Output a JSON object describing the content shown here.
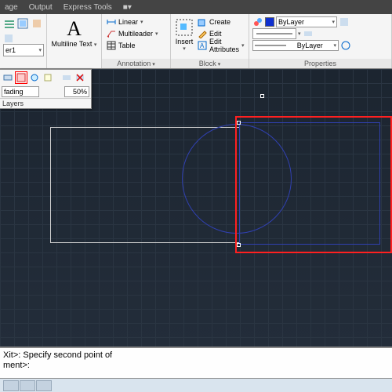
{
  "titlebar": {
    "tab1": "age",
    "tab2": "Output",
    "tab3": "Express Tools",
    "tab4_icon": "■▾"
  },
  "layers": {
    "combo_value": "er1",
    "panel_title": ""
  },
  "multiline": {
    "big_letter": "A",
    "label": "Multiline Text",
    "arrow": "▾"
  },
  "annotation": {
    "linear": "Linear",
    "multileader": "Multileader",
    "table": "Table",
    "panel_title": "Annotation"
  },
  "block": {
    "insert": "Insert",
    "create": "Create",
    "edit": "Edit",
    "edit_attr": "Edit Attributes",
    "panel_title": "Block"
  },
  "properties": {
    "color_value": "ByLayer",
    "linetype_value": "ByLayer",
    "lineweight_sample": "———",
    "panel_title": "Properties"
  },
  "floating": {
    "input_value": "fading",
    "percent_value": "50%",
    "footer": "Layers"
  },
  "command": {
    "line1": "Xit>: Specify second point of",
    "line2": "ment>:"
  },
  "colors": {
    "red": "#ff2020",
    "blue": "#3040b0",
    "bylayer_swatch": "#1030d0"
  }
}
